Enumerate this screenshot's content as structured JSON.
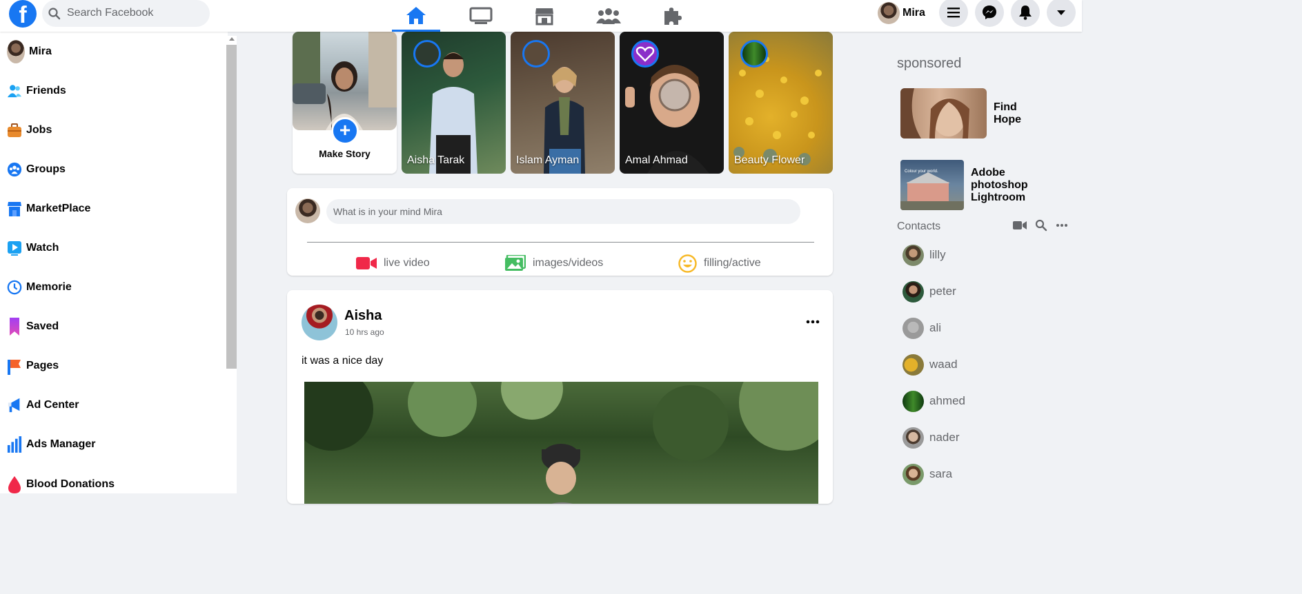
{
  "header": {
    "logo_letter": "f",
    "search_placeholder": "Search Facebook",
    "nav_tabs": [
      "home-icon",
      "watch-icon",
      "marketplace-icon",
      "groups-icon",
      "gaming-icon"
    ],
    "user_name": "Mira",
    "action_icons": [
      "menu-icon",
      "messenger-icon",
      "notifications-icon",
      "account-caret-icon"
    ]
  },
  "sidebar": {
    "items": [
      {
        "label": "Mira",
        "icon": "avatar"
      },
      {
        "label": "Friends",
        "icon": "friends-icon"
      },
      {
        "label": "Jobs",
        "icon": "jobs-icon"
      },
      {
        "label": "Groups",
        "icon": "groups-icon"
      },
      {
        "label": "MarketPlace",
        "icon": "marketplace-icon"
      },
      {
        "label": "Watch",
        "icon": "watch-icon"
      },
      {
        "label": "Memorie",
        "icon": "memories-icon"
      },
      {
        "label": "Saved",
        "icon": "saved-icon"
      },
      {
        "label": "Pages",
        "icon": "pages-icon"
      },
      {
        "label": "Ad Center",
        "icon": "ad-center-icon"
      },
      {
        "label": "Ads Manager",
        "icon": "ads-manager-icon"
      },
      {
        "label": "Blood Donations",
        "icon": "blood-donations-icon"
      }
    ]
  },
  "stories": {
    "make_story_label": "Make Story",
    "items": [
      {
        "name": "Aisha Tarak"
      },
      {
        "name": "Islam Ayman"
      },
      {
        "name": "Amal Ahmad"
      },
      {
        "name": "Beauty Flower"
      }
    ]
  },
  "composer": {
    "placeholder": "What is in your mind Mira",
    "actions": [
      {
        "label": "live video",
        "icon": "live-video-icon",
        "color": "#f02849"
      },
      {
        "label": "images/videos",
        "icon": "photo-icon",
        "color": "#45bd62"
      },
      {
        "label": "filling/active",
        "icon": "feeling-icon",
        "color": "#f7b928"
      }
    ]
  },
  "post": {
    "author": "Aisha",
    "time": "10 hrs ago",
    "text": "it was a nice day"
  },
  "right": {
    "sponsored_title": "sponsored",
    "ads": [
      {
        "lines": [
          "Find",
          "Hope"
        ]
      },
      {
        "lines": [
          "Adobe",
          "photoshop",
          "Lightroom"
        ],
        "image_caption": "Colour your world."
      }
    ],
    "contacts_title": "Contacts",
    "contacts": [
      "lilly",
      "peter",
      "ali",
      "waad",
      "ahmed",
      "nader",
      "sara"
    ]
  },
  "colors": {
    "brand": "#1877f2",
    "background": "#f0f2f5",
    "secondary_text": "#65676b"
  }
}
